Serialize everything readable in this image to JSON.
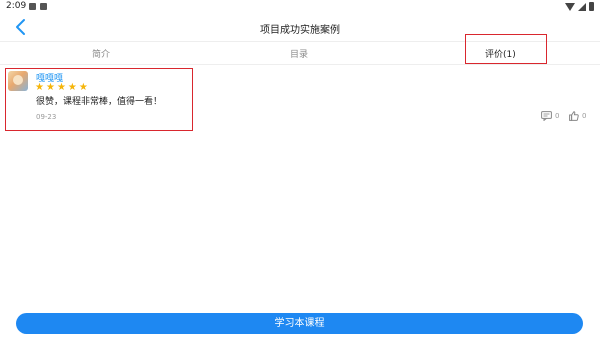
{
  "status_bar": {
    "time": "2:09",
    "icons": [
      "image-icon",
      "notification-icon",
      "wifi-icon",
      "signal-icon",
      "battery-icon"
    ]
  },
  "header": {
    "title": "项目成功实施案例",
    "back_icon": "back-arrow-icon"
  },
  "tabs": [
    {
      "label": "简介",
      "active": false
    },
    {
      "label": "目录",
      "active": false
    },
    {
      "label": "评价(1)",
      "active": true
    }
  ],
  "review": {
    "user_name": "嘎嘎嘎",
    "rating": 5,
    "text": "很赞，课程非常棒，值得一看！",
    "date": "09-23",
    "reply_count": "0",
    "like_count": "0"
  },
  "footer": {
    "button_label": "学习本课程"
  },
  "colors": {
    "accent": "#1e88f2",
    "highlight": "#d9272e",
    "star": "#f5b50a"
  }
}
